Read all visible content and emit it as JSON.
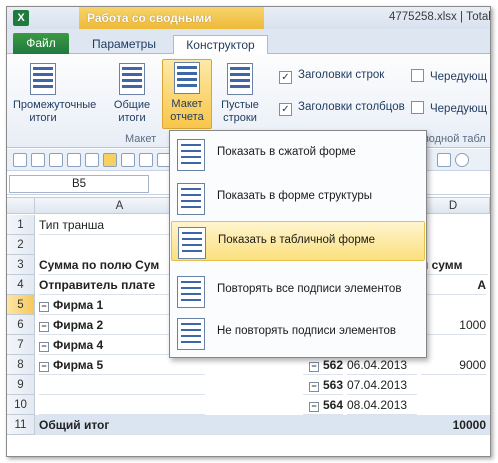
{
  "window": {
    "app_icon": "excel-icon",
    "context_tab": "Работа со сводными таблицами",
    "title": "4775258.xlsx | Тоtal"
  },
  "tabs": {
    "file": "Файл",
    "params": "Параметры",
    "constructor": "Конструктор"
  },
  "ribbon": {
    "btn_subtotals": "Промежуточные итоги",
    "btn_grandtotals": "Общие итоги",
    "btn_report_layout": "Макет отчета",
    "btn_blank_rows": "Пустые строки",
    "group_layout": "Макет",
    "chk_row_headers": "Заголовки строк",
    "chk_col_headers": "Заголовки столбцов",
    "chk_banded_rows": "Чередующ",
    "chk_banded_cols": "Чередующ",
    "group_style_options": "водной табл"
  },
  "formula": {
    "namebox": "B5"
  },
  "columns": [
    "A",
    "D"
  ],
  "rows": [
    {
      "num": "1",
      "a": "Тип транша",
      "d": ""
    },
    {
      "num": "2",
      "a": "",
      "d": ""
    },
    {
      "num": "3",
      "a": "Сумма по полю Сум",
      "d": "п сумм"
    },
    {
      "num": "4",
      "a": "Отправитель плате",
      "d": "А"
    },
    {
      "num": "5",
      "a": "Фирма 1",
      "d": ""
    },
    {
      "num": "6",
      "a": "Фирма 2",
      "d": "1000"
    },
    {
      "num": "7",
      "a": "Фирма 4",
      "d": ""
    },
    {
      "num": "8",
      "a": "Фирма 5",
      "d": "9000"
    },
    {
      "num": "9",
      "a": "",
      "d": ""
    },
    {
      "num": "10",
      "a": "",
      "d": ""
    },
    {
      "num": "11",
      "a": "Общий итог",
      "d": "10000"
    }
  ],
  "sub_rows": [
    {
      "id": "562",
      "date": "06.04.2013"
    },
    {
      "id": "563",
      "date": "07.04.2013"
    },
    {
      "id": "564",
      "date": "08.04.2013"
    }
  ],
  "menu": {
    "compact": "Показать в сжатой форме",
    "outline": "Показать в форме структуры",
    "tabular": "Показать в табличной форме",
    "repeat": "Повторять все подписи элементов",
    "no_repeat": "Не повторять подписи элементов"
  }
}
